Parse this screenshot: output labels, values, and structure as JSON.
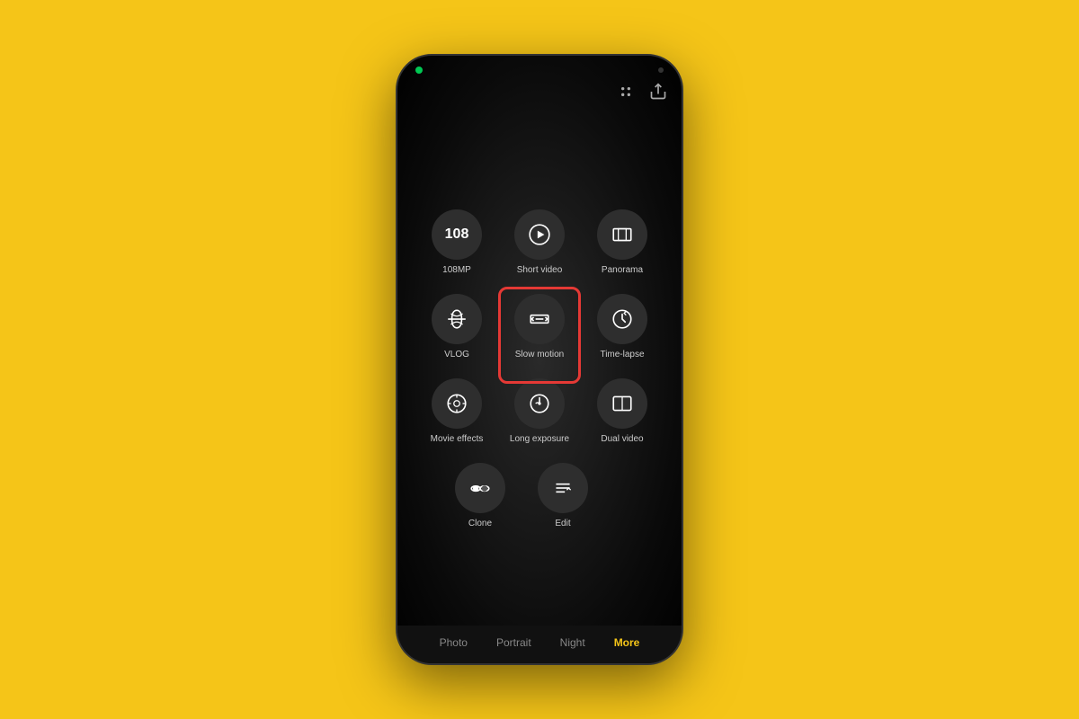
{
  "background_color": "#F5C518",
  "phone": {
    "status_dot_color": "#00c853"
  },
  "top_icons": {
    "grid_icon": "⊞",
    "share_icon": "↗"
  },
  "grid": {
    "rows": [
      [
        {
          "id": "108mp",
          "label": "108MP",
          "type": "text"
        },
        {
          "id": "short-video",
          "label": "Short video",
          "type": "play"
        },
        {
          "id": "panorama",
          "label": "Panorama",
          "type": "panorama"
        }
      ],
      [
        {
          "id": "vlog",
          "label": "VLOG",
          "type": "vlog"
        },
        {
          "id": "slow-motion",
          "label": "Slow motion",
          "type": "slow",
          "highlighted": true
        },
        {
          "id": "time-lapse",
          "label": "Time-lapse",
          "type": "timelapse"
        }
      ],
      [
        {
          "id": "movie-effects",
          "label": "Movie effects",
          "type": "movie"
        },
        {
          "id": "long-exposure",
          "label": "Long exposure",
          "type": "longexp"
        },
        {
          "id": "dual-video",
          "label": "Dual video",
          "type": "dual"
        }
      ],
      [
        {
          "id": "clone",
          "label": "Clone",
          "type": "clone"
        },
        {
          "id": "edit",
          "label": "Edit",
          "type": "edit"
        }
      ]
    ]
  },
  "nav": {
    "items": [
      {
        "label": "Photo",
        "active": false
      },
      {
        "label": "Portrait",
        "active": false
      },
      {
        "label": "Night",
        "active": false
      },
      {
        "label": "More",
        "active": true
      }
    ]
  },
  "highlight": {
    "border_color": "#e53935"
  }
}
